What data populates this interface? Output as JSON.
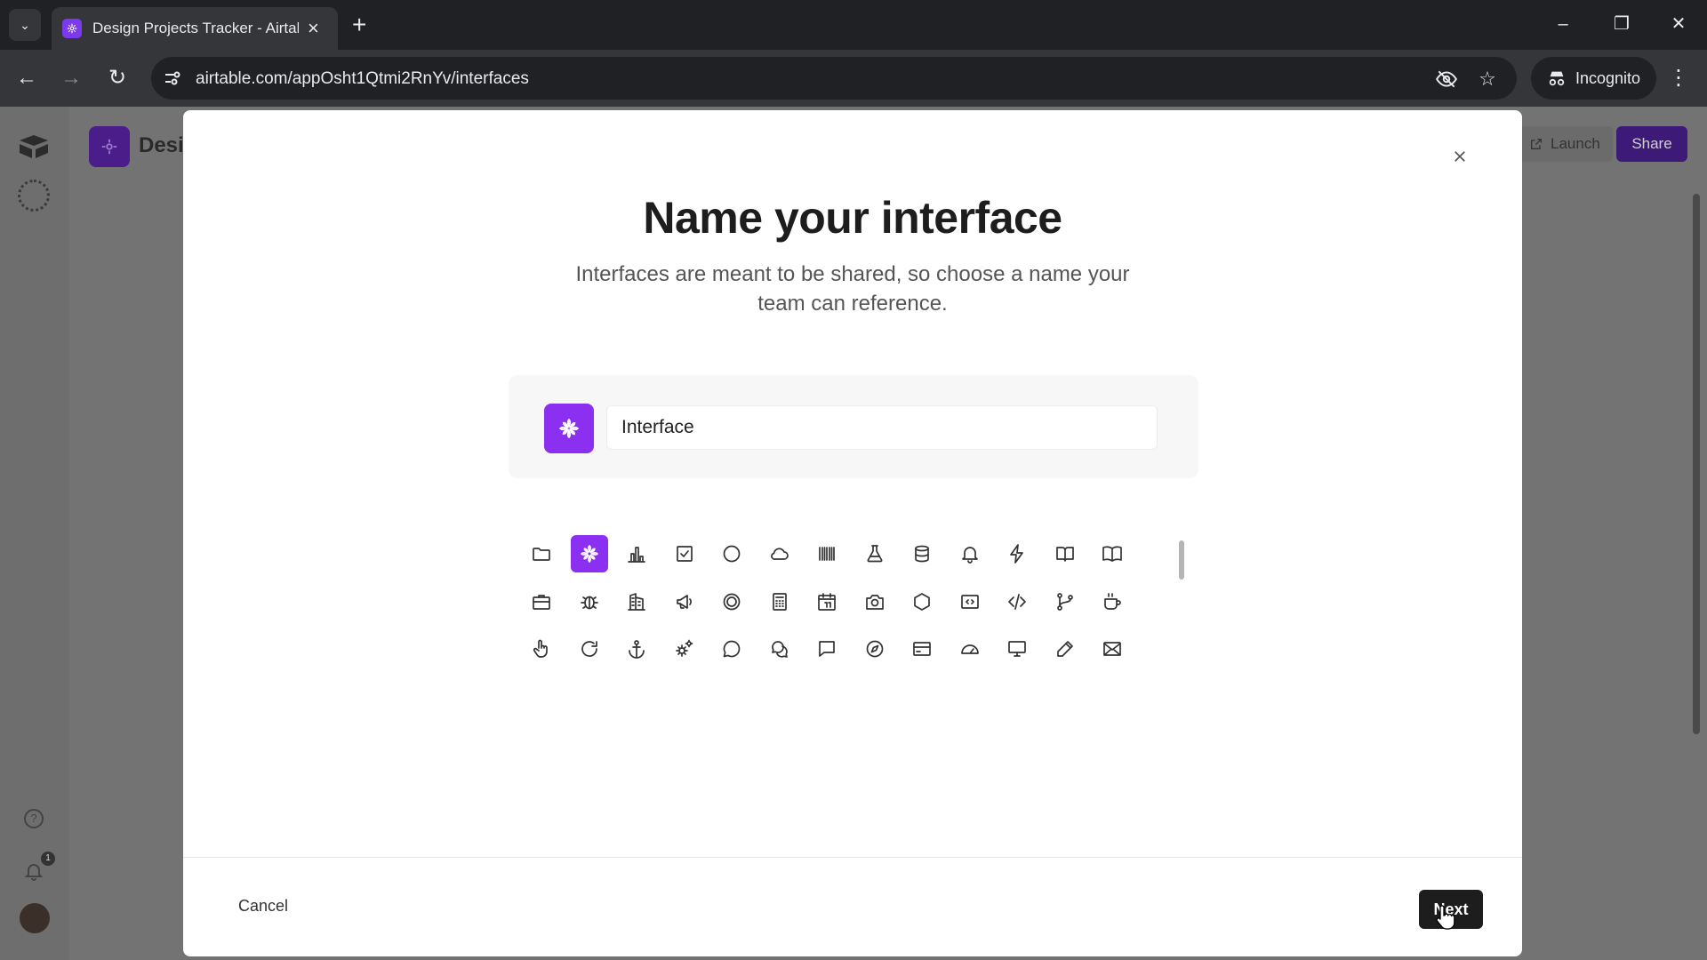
{
  "browser": {
    "tab_title": "Design Projects Tracker - Airtable",
    "url": "airtable.com/appOsht1Qtmi2RnYv/interfaces",
    "incognito_label": "Incognito"
  },
  "app": {
    "base_name": "Desi",
    "launch_label": "Launch",
    "share_label": "Share",
    "notification_count": "1",
    "brand_color": "#8b2ff0"
  },
  "modal": {
    "title": "Name your interface",
    "subtitle": "Interfaces are meant to be shared, so choose a name your team can reference.",
    "name_value": "Interface",
    "selected_icon": "flower-icon",
    "icons": [
      [
        "folder-icon",
        "flower-icon",
        "bar-chart-icon",
        "checkbox-icon",
        "circle-icon",
        "cloud-icon",
        "barcode-icon",
        "flask-icon",
        "database-icon",
        "bell-icon",
        "lightning-icon",
        "book-open-icon",
        "book-icon"
      ],
      [
        "briefcase-icon",
        "bug-icon",
        "buildings-icon",
        "megaphone-icon",
        "target-icon",
        "calculator-icon",
        "calendar-icon",
        "camera-icon",
        "hexagon-icon",
        "code-block-icon",
        "code-icon",
        "git-branch-icon",
        "coffee-icon"
      ],
      [
        "hand-pointer-icon",
        "redo-icon",
        "anchor-icon",
        "gears-icon",
        "chat-icon",
        "chats-icon",
        "chat-square-icon",
        "compass-icon",
        "credit-card-icon",
        "gauge-icon",
        "monitor-icon",
        "pencil-icon",
        "envelope-icon"
      ]
    ],
    "cancel_label": "Cancel",
    "next_label": "Next"
  }
}
